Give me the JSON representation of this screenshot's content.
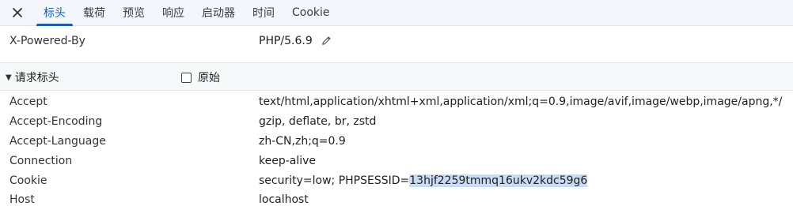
{
  "tabs": [
    {
      "label": "标头"
    },
    {
      "label": "载荷"
    },
    {
      "label": "预览"
    },
    {
      "label": "响应"
    },
    {
      "label": "启动器"
    },
    {
      "label": "时间"
    },
    {
      "label": "Cookie"
    }
  ],
  "response_headers_tail": {
    "name": "X-Powered-By",
    "value": "PHP/5.6.9"
  },
  "request_section": {
    "title": "请求标头",
    "raw_label": "原始",
    "raw_checked": false
  },
  "request_headers": [
    {
      "name": "Accept",
      "value": "text/html,application/xhtml+xml,application/xml;q=0.9,image/avif,image/webp,image/apng,*/"
    },
    {
      "name": "Accept-Encoding",
      "value": "gzip, deflate, br, zstd"
    },
    {
      "name": "Accept-Language",
      "value": "zh-CN,zh;q=0.9"
    },
    {
      "name": "Connection",
      "value": "keep-alive"
    },
    {
      "name": "Cookie",
      "value_prefix": "security=low; PHPSESSID=",
      "value_selected": "13hjf2259tmmq16ukv2kdc59g6"
    },
    {
      "name": "Host",
      "value": "localhost"
    }
  ],
  "icons": {
    "close": "close-icon",
    "edit": "pencil-icon",
    "collapse": "triangle-down-icon"
  },
  "colors": {
    "accent": "#1a5fb4",
    "selection": "#c9dcf5"
  }
}
